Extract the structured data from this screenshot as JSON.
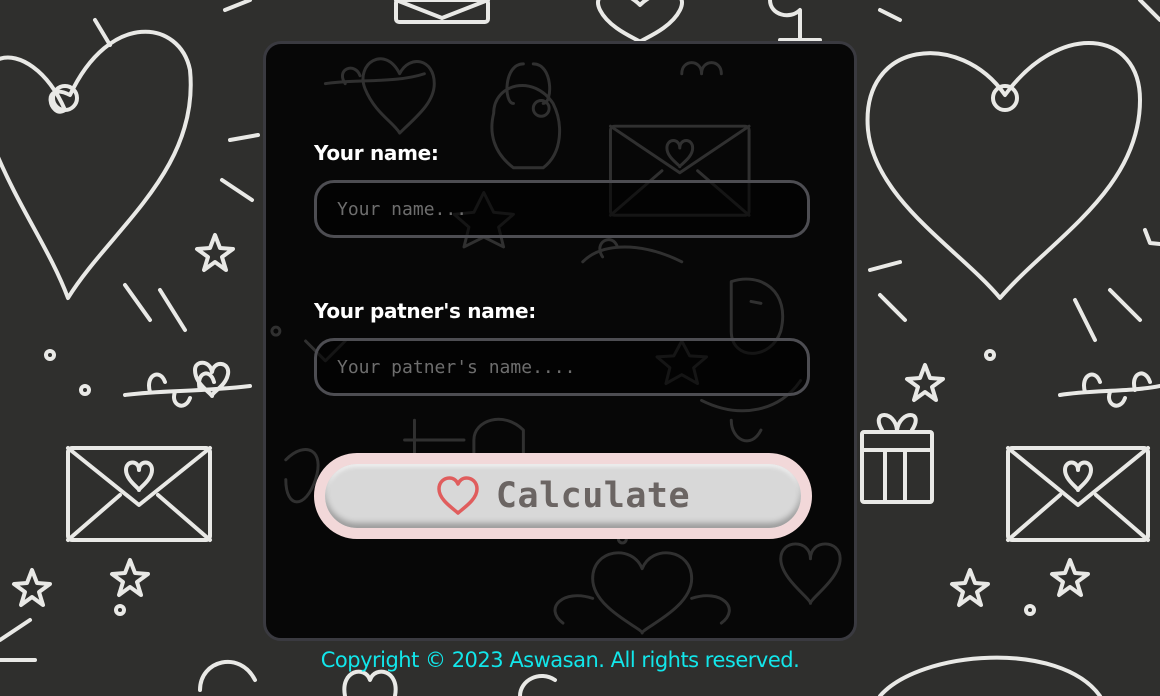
{
  "form": {
    "name_label": "Your name:",
    "name_placeholder": "Your name...",
    "name_value": "",
    "partner_label": "Your patner's name:",
    "partner_placeholder": "Your patner's name....",
    "partner_value": "",
    "calculate_label": "Calculate",
    "calculate_icon": "heart-outline-icon"
  },
  "footer": {
    "copyright": "Copyright © 2023 Aswasan. All rights reserved."
  },
  "colors": {
    "page_background": "#2f2f2d",
    "card_background": "#050505",
    "label_text": "#ffffff",
    "button_border": "#f2d8d9",
    "heart_icon": "#e05d5d",
    "footer_text": "#12e6ea"
  }
}
